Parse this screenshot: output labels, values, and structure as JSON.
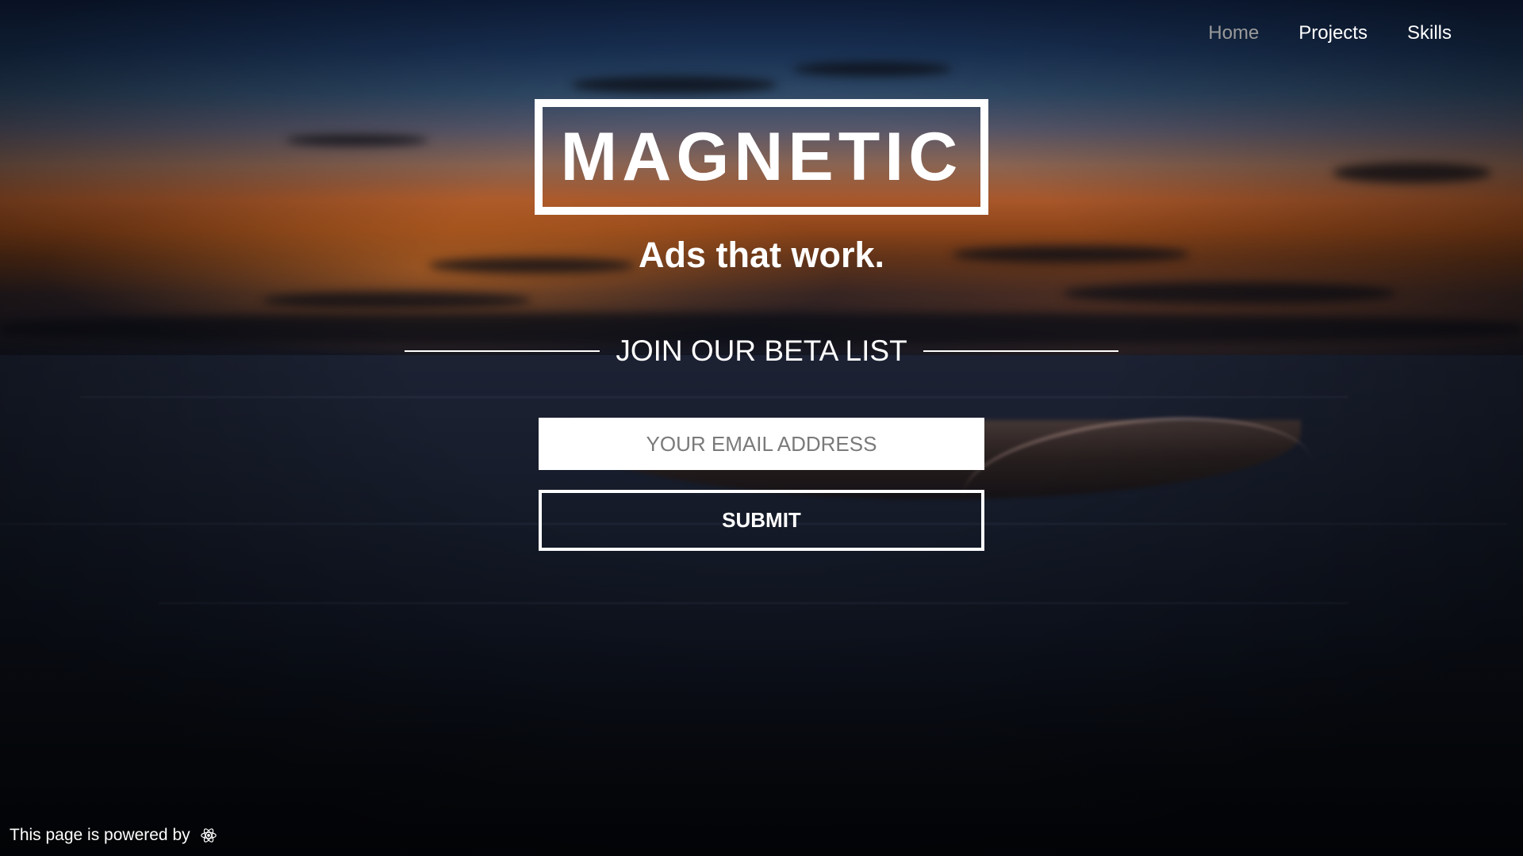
{
  "nav": {
    "items": [
      {
        "label": "Home",
        "active": true
      },
      {
        "label": "Projects",
        "active": false
      },
      {
        "label": "Skills",
        "active": false
      }
    ]
  },
  "hero": {
    "logo_text": "MAGNETIC",
    "tagline": "Ads that work."
  },
  "beta": {
    "title": "JOIN OUR BETA LIST",
    "email_placeholder": "YOUR EMAIL ADDRESS",
    "submit_label": "SUBMIT"
  },
  "footer": {
    "powered_text": "This page is powered by",
    "powered_icon": "react-icon"
  },
  "colors": {
    "text": "#ffffff",
    "nav_active": "#9a9a9a",
    "input_bg": "#ffffff",
    "placeholder": "#7a7a7a"
  }
}
